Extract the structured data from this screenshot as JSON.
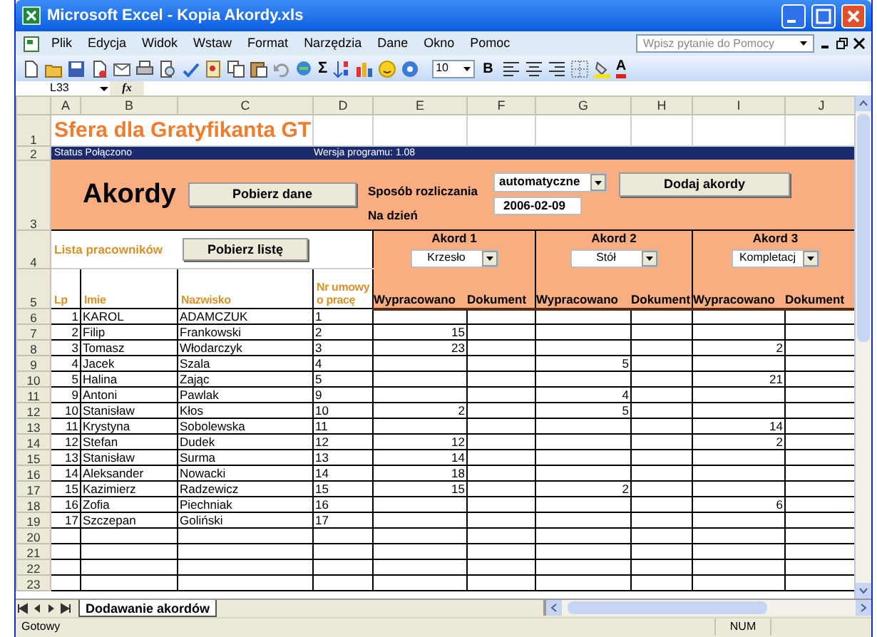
{
  "window": {
    "title": "Microsoft Excel - Kopia Akordy.xls"
  },
  "menu": [
    {
      "label": "Plik"
    },
    {
      "label": "Edycja"
    },
    {
      "label": "Widok"
    },
    {
      "label": "Wstaw"
    },
    {
      "label": "Format"
    },
    {
      "label": "Narzędzia"
    },
    {
      "label": "Dane"
    },
    {
      "label": "Okno"
    },
    {
      "label": "Pomoc"
    }
  ],
  "help_box": {
    "placeholder": "Wpisz pytanie do Pomocy"
  },
  "toolbar": {
    "autosum": "Σ",
    "font_size": "10",
    "bold": "B",
    "font_color": "A"
  },
  "formula_bar": {
    "name_box": "L33",
    "fx": "fx"
  },
  "columns": [
    "A",
    "B",
    "C",
    "D",
    "E",
    "F",
    "G",
    "H",
    "I",
    "J"
  ],
  "sheet": {
    "title_row": "1",
    "title": "Sfera dla Gratyfikanta GT",
    "status_row": "2",
    "status": "Status Połączono",
    "version": "Wersja programu: 1.08",
    "form_row": "3",
    "heading": "Akordy",
    "fetch_data_button": "Pobierz dane",
    "settlement_label": "Sposób rozliczania",
    "settlement_value": "automatyczne",
    "date_label": "Na dzień",
    "date_value": "2006-02-09",
    "add_button": "Dodaj akordy",
    "list_row": "4",
    "list_label": "Lista pracowników",
    "fetch_list_button": "Pobierz listę",
    "akords": [
      {
        "title": "Akord 1",
        "choice": "Krzesło",
        "sub_headers": [
          "Wypracowano",
          "Dokument"
        ]
      },
      {
        "title": "Akord 2",
        "choice": "Stół",
        "sub_headers": [
          "Wypracowano",
          "Dokument"
        ]
      },
      {
        "title": "Akord 3",
        "choice": "Kompletacj",
        "sub_headers": [
          "Wypracowano",
          "Dokument"
        ]
      }
    ],
    "header_row": "5",
    "headers": [
      "Lp",
      "Imie",
      "Nazwisko",
      "Nr umowy o pracę"
    ],
    "rows": [
      {
        "row": "6",
        "lp": "1",
        "first": "KAROL",
        "last": "ADAMCZUK",
        "contract": "1"
      },
      {
        "row": "7",
        "lp": "2",
        "first": "Filip",
        "last": "Frankowski",
        "contract": "2",
        "akord_1": "15"
      },
      {
        "row": "8",
        "lp": "3",
        "first": "Tomasz",
        "last": "Włodarczyk",
        "contract": "3",
        "akord_1": "23",
        "akord_3": "2"
      },
      {
        "row": "9",
        "lp": "4",
        "first": "Jacek",
        "last": "Szala",
        "contract": "4",
        "akord_2": "5"
      },
      {
        "row": "10",
        "lp": "5",
        "first": "Halina",
        "last": "Zając",
        "contract": "5",
        "akord_3": "21"
      },
      {
        "row": "11",
        "lp": "9",
        "first": "Antoni",
        "last": "Pawlak",
        "contract": "9",
        "akord_2": "4"
      },
      {
        "row": "12",
        "lp": "10",
        "first": "Stanisław",
        "last": "Kłos",
        "contract": "10",
        "akord_1": "2",
        "akord_2": "5"
      },
      {
        "row": "13",
        "lp": "11",
        "first": "Krystyna",
        "last": "Sobolewska",
        "contract": "11",
        "akord_3": "14"
      },
      {
        "row": "14",
        "lp": "12",
        "first": "Stefan",
        "last": "Dudek",
        "contract": "12",
        "akord_1": "12",
        "akord_3": "2"
      },
      {
        "row": "15",
        "lp": "13",
        "first": "Stanisław",
        "last": "Surma",
        "contract": "13",
        "akord_1": "14"
      },
      {
        "row": "16",
        "lp": "14",
        "first": "Aleksander",
        "last": "Nowacki",
        "contract": "14",
        "akord_1": "18"
      },
      {
        "row": "17",
        "lp": "15",
        "first": "Kazimierz",
        "last": "Radzewicz",
        "contract": "15",
        "akord_1": "15",
        "akord_2": "2"
      },
      {
        "row": "18",
        "lp": "16",
        "first": "Zofia",
        "last": "Piechniak",
        "contract": "16",
        "akord_3": "6"
      },
      {
        "row": "19",
        "lp": "17",
        "first": "Szczepan",
        "last": "Goliński",
        "contract": "17"
      }
    ],
    "empty_rows": [
      "20",
      "21",
      "22",
      "23"
    ]
  },
  "sheet_tabs": [
    {
      "label": "Dodawanie akordów",
      "selected": true
    }
  ],
  "status_bar": {
    "text": "Gotowy",
    "num": "NUM"
  }
}
